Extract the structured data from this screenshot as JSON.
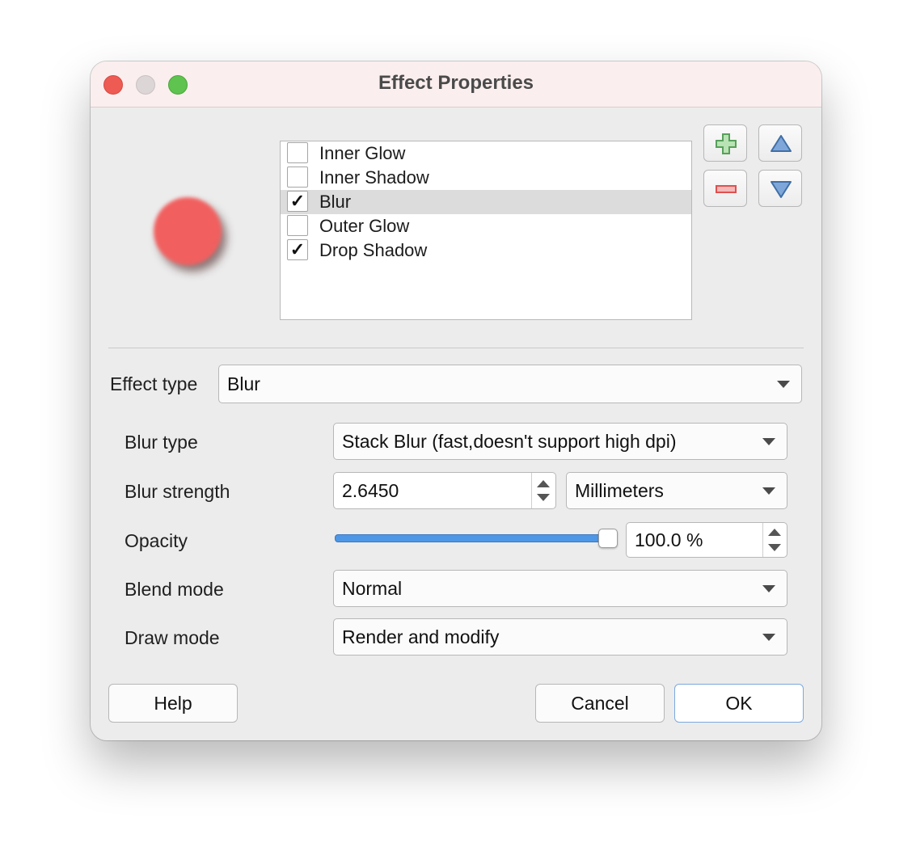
{
  "window": {
    "title": "Effect Properties"
  },
  "effects": [
    {
      "label": "Inner Glow",
      "checked": false,
      "selected": false
    },
    {
      "label": "Inner Shadow",
      "checked": false,
      "selected": false
    },
    {
      "label": "Blur",
      "checked": true,
      "selected": true
    },
    {
      "label": "Outer Glow",
      "checked": false,
      "selected": false
    },
    {
      "label": "Drop Shadow",
      "checked": true,
      "selected": false
    }
  ],
  "check_mark": "✓",
  "form": {
    "effect_type_label": "Effect type",
    "effect_type_value": "Blur",
    "blur_type_label": "Blur type",
    "blur_type_value": "Stack Blur (fast,doesn't support high dpi)",
    "blur_strength_label": "Blur strength",
    "blur_strength_value": "2.6450",
    "blur_strength_unit": "Millimeters",
    "opacity_label": "Opacity",
    "opacity_value": "100.0 %",
    "opacity_fraction": 1.0,
    "blend_mode_label": "Blend mode",
    "blend_mode_value": "Normal",
    "draw_mode_label": "Draw mode",
    "draw_mode_value": "Render and modify"
  },
  "buttons": {
    "help": "Help",
    "cancel": "Cancel",
    "ok": "OK"
  },
  "icons": {
    "add": "plus-icon",
    "remove": "minus-icon",
    "move_up": "triangle-up-icon",
    "move_down": "triangle-down-icon"
  },
  "colors": {
    "preview": "#f15f5f",
    "slider_fill": "#4d97e6",
    "add_icon": "#57a05a",
    "remove_icon": "#e05050",
    "arrow_icon": "#5b8cc8"
  }
}
